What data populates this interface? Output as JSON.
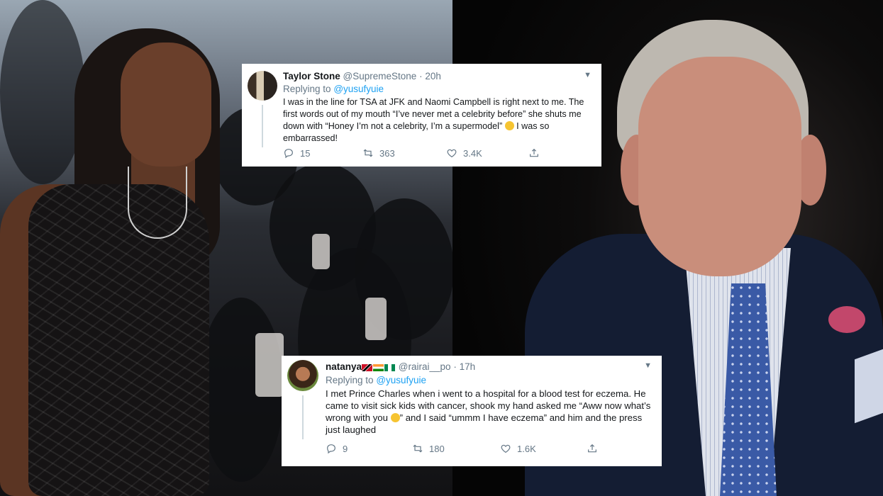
{
  "tweets": [
    {
      "display_name": "Taylor Stone",
      "handle": "@SupremeStone",
      "separator": "·",
      "time": "20h",
      "replying_prefix": "Replying to",
      "replying_to": "@yusufyuie",
      "text_1": "I was in the line for TSA at JFK and Naomi Campbell is right next to me. The first words out of my mouth “I’ve never met a celebrity before” she shuts me down with “Honey I’m not a celebrity, I’m a supermodel”",
      "text_2": "I was so embarrassed!",
      "replies": "15",
      "retweets": "363",
      "likes": "3.4K"
    },
    {
      "display_name": "natanya",
      "handle": "@rairai__po",
      "separator": "·",
      "time": "17h",
      "replying_prefix": "Replying to",
      "replying_to": "@yusufyuie",
      "text_1": "I met Prince Charles when i went to a hospital for a blood test for eczema. He came to visit sick kids with cancer, shook my hand asked me “Aww now what’s wrong with you",
      "text_2": "” and I said “ummm I have eczema” and him and the press just laughed",
      "replies": "9",
      "retweets": "180",
      "likes": "1.6K"
    }
  ],
  "icons": {
    "reply": "reply-icon",
    "retweet": "retweet-icon",
    "like": "heart-icon",
    "share": "share-icon",
    "caret": "chevron-down-icon",
    "flags": [
      "trinidad-tobago-flag",
      "india-flag",
      "nigeria-flag"
    ]
  },
  "colors": {
    "link": "#1da1f2",
    "muted": "#657786",
    "text": "#14171a"
  }
}
